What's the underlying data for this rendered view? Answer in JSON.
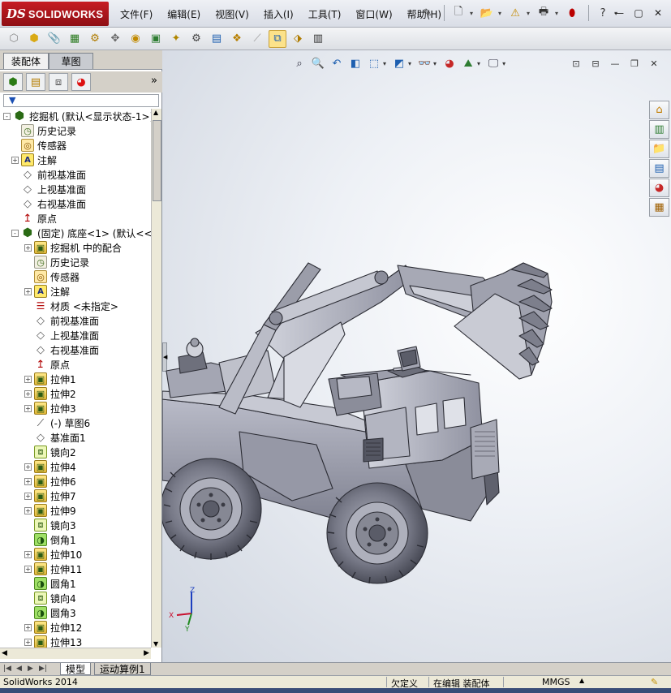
{
  "app": {
    "logo_ds": "DS",
    "logo_name": "SOLIDWORKS"
  },
  "menu": [
    "文件(F)",
    "编辑(E)",
    "视图(V)",
    "插入(I)",
    "工具(T)",
    "窗口(W)",
    "帮助(H)"
  ],
  "title_tools": [
    "pin-icon",
    "new-document-icon",
    "open-icon",
    "rebuild-warning-icon",
    "print-icon",
    "traffic-light-icon",
    "help-icon"
  ],
  "window_controls": [
    "minimize-icon",
    "restore-icon",
    "close-icon"
  ],
  "command_toolbar": [
    "edit-component-icon",
    "insert-components-icon",
    "mate-icon",
    "linear-pattern-icon",
    "smart-fasteners-icon",
    "move-component-icon",
    "show-hidden-icon",
    "assembly-features-icon",
    "reference-geometry-icon",
    "new-motion-study-icon",
    "bill-of-materials-icon",
    "exploded-view-icon",
    "explode-line-sketch-icon",
    "interference-detection-icon",
    "clearance-verification-icon",
    "assembly-visualization-icon"
  ],
  "left_panel": {
    "tabs": [
      "装配体",
      "草图"
    ],
    "active_tab": "草图",
    "more_label": "»",
    "filter_label": "▼"
  },
  "tree": [
    {
      "level": 0,
      "expander": "-",
      "icon": "asm",
      "label": "挖掘机  (默认<显示状态-1>)"
    },
    {
      "level": 1,
      "expander": "",
      "icon": "hist",
      "label": "历史记录"
    },
    {
      "level": 1,
      "expander": "",
      "icon": "sensor",
      "label": "传感器"
    },
    {
      "level": 1,
      "expander": "+",
      "icon": "note",
      "label": "注解"
    },
    {
      "level": 1,
      "expander": "",
      "icon": "plane",
      "label": "前视基准面"
    },
    {
      "level": 1,
      "expander": "",
      "icon": "plane",
      "label": "上视基准面"
    },
    {
      "level": 1,
      "expander": "",
      "icon": "plane",
      "label": "右视基准面"
    },
    {
      "level": 1,
      "expander": "",
      "icon": "origin",
      "label": "原点"
    },
    {
      "level": 1,
      "expander": "-",
      "icon": "asm",
      "label": "(固定) 底座<1> (默认<<默"
    },
    {
      "level": 2,
      "expander": "+",
      "icon": "feat",
      "label": "挖掘机 中的配合"
    },
    {
      "level": 2,
      "expander": "",
      "icon": "hist",
      "label": "历史记录"
    },
    {
      "level": 2,
      "expander": "",
      "icon": "sensor",
      "label": "传感器"
    },
    {
      "level": 2,
      "expander": "+",
      "icon": "note",
      "label": "注解"
    },
    {
      "level": 2,
      "expander": "",
      "icon": "mat",
      "label": "材质 <未指定>"
    },
    {
      "level": 2,
      "expander": "",
      "icon": "plane",
      "label": "前视基准面"
    },
    {
      "level": 2,
      "expander": "",
      "icon": "plane",
      "label": "上视基准面"
    },
    {
      "level": 2,
      "expander": "",
      "icon": "plane",
      "label": "右视基准面"
    },
    {
      "level": 2,
      "expander": "",
      "icon": "origin",
      "label": "原点"
    },
    {
      "level": 2,
      "expander": "+",
      "icon": "feat",
      "label": "拉伸1"
    },
    {
      "level": 2,
      "expander": "+",
      "icon": "feat",
      "label": "拉伸2"
    },
    {
      "level": 2,
      "expander": "+",
      "icon": "feat",
      "label": "拉伸3"
    },
    {
      "level": 2,
      "expander": "",
      "icon": "sketch",
      "label": "(-) 草图6"
    },
    {
      "level": 2,
      "expander": "",
      "icon": "plane",
      "label": "基准面1"
    },
    {
      "level": 2,
      "expander": "",
      "icon": "mirror",
      "label": "镜向2"
    },
    {
      "level": 2,
      "expander": "+",
      "icon": "feat",
      "label": "拉伸4"
    },
    {
      "level": 2,
      "expander": "+",
      "icon": "feat",
      "label": "拉伸6"
    },
    {
      "level": 2,
      "expander": "+",
      "icon": "feat",
      "label": "拉伸7"
    },
    {
      "level": 2,
      "expander": "+",
      "icon": "feat",
      "label": "拉伸9"
    },
    {
      "level": 2,
      "expander": "",
      "icon": "mirror",
      "label": "镜向3"
    },
    {
      "level": 2,
      "expander": "",
      "icon": "fillet",
      "label": "倒角1"
    },
    {
      "level": 2,
      "expander": "+",
      "icon": "feat",
      "label": "拉伸10"
    },
    {
      "level": 2,
      "expander": "+",
      "icon": "feat",
      "label": "拉伸11"
    },
    {
      "level": 2,
      "expander": "",
      "icon": "fillet",
      "label": "圆角1"
    },
    {
      "level": 2,
      "expander": "",
      "icon": "mirror",
      "label": "镜向4"
    },
    {
      "level": 2,
      "expander": "",
      "icon": "fillet",
      "label": "圆角3"
    },
    {
      "level": 2,
      "expander": "+",
      "icon": "feat",
      "label": "拉伸12"
    },
    {
      "level": 2,
      "expander": "+",
      "icon": "feat",
      "label": "拉伸13"
    }
  ],
  "view_toolbar": [
    "zoom-to-fit-icon",
    "zoom-to-area-icon",
    "previous-view-icon",
    "section-view-icon",
    "view-orientation-icon",
    "display-style-icon",
    "hide-show-items-icon",
    "edit-appearance-icon",
    "apply-scene-icon",
    "view-settings-icon"
  ],
  "task_pane": [
    "solidworks-resources-icon",
    "design-library-icon",
    "file-explorer-icon",
    "view-palette-icon",
    "appearances-icon",
    "custom-properties-icon"
  ],
  "triad": {
    "x": "X",
    "y": "Y",
    "z": "Z"
  },
  "bottom_tabs": [
    "模型",
    "运动算例1"
  ],
  "status": {
    "version": "SolidWorks 2014",
    "underdefined": "欠定义",
    "editing": "在编辑 装配体",
    "units": "MMGS"
  },
  "colors": {
    "brand_red": "#b5161c",
    "model_gray": "#8a8c99",
    "viewport_bg": "#eef1f6"
  }
}
